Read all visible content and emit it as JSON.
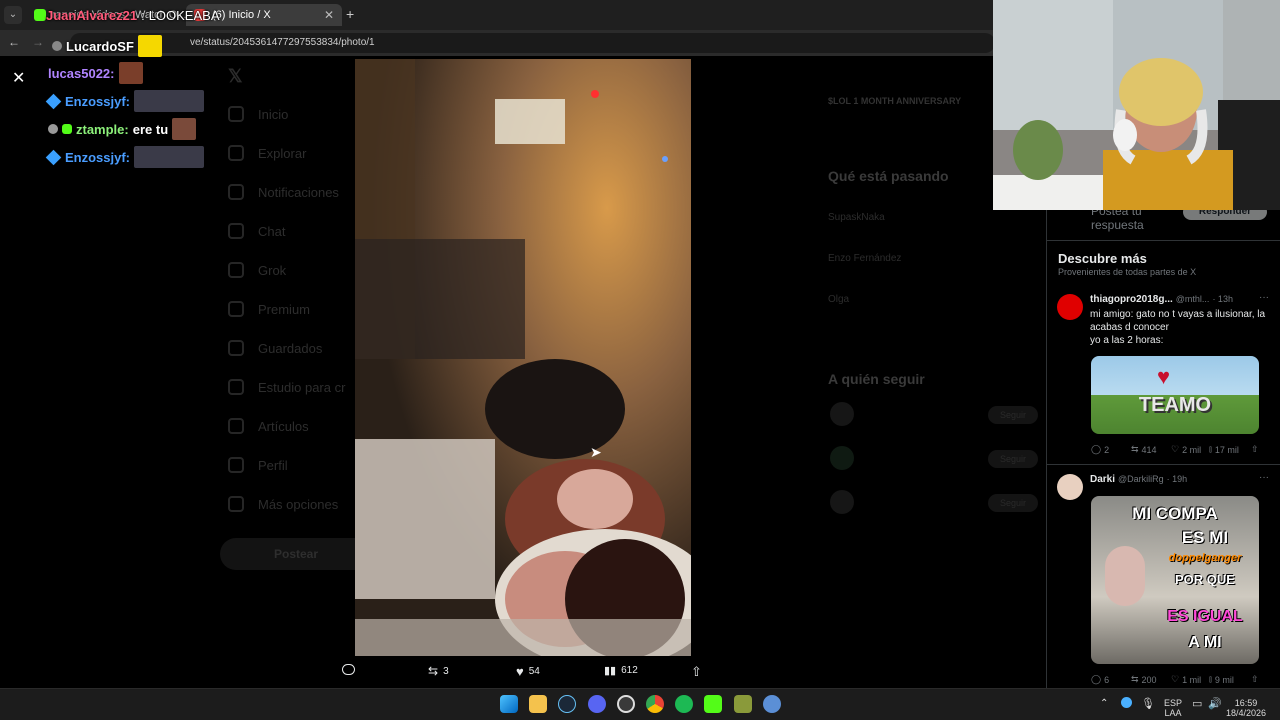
{
  "browser": {
    "tab1_title": "ranoide Videos - Watch O...",
    "tab2_title": "(6) Inicio / X",
    "url": "ve/status/2045361477297553834/photo/1",
    "new_tab_icon": "plus-icon"
  },
  "chat": {
    "overlay_top_user": "JuanAlvarez21",
    "overlay_top_msg": "LOOKEABA",
    "overlay_second_user": "LucardoSF",
    "messages": [
      {
        "user": "lucas5022:",
        "color": "#b084ff",
        "text": ""
      },
      {
        "user": "Enzossjyf:",
        "color": "#4a9dff",
        "text": ""
      },
      {
        "user": "ztample:",
        "color": "#8cf07a",
        "text": "ere tu"
      },
      {
        "user": "Enzossjyf:",
        "color": "#4a9dff",
        "text": ""
      }
    ]
  },
  "sidebar": {
    "items": [
      "Inicio",
      "Explorar",
      "Notificaciones",
      "Chat",
      "Grok",
      "Premium",
      "Guardados",
      "Estudio para cr",
      "Artículos",
      "Perfil",
      "Más opciones"
    ],
    "post_label": "Postear"
  },
  "trends": {
    "header": "Qué está pasando",
    "event": "$LOL 1 MONTH ANNIVERSARY",
    "items": [
      "SupaskNaka",
      "Enzo Fernández",
      "Olga"
    ],
    "follow_header": "A quién seguir",
    "follow_label": "Seguir"
  },
  "photo_actions": {
    "replies": "",
    "reposts": "3",
    "likes": "54",
    "views": "612"
  },
  "right_panel": {
    "reply_placeholder": "Postea tu respuesta",
    "reply_button": "Responder",
    "discover_title": "Descubre más",
    "discover_sub": "Provenientes de todas partes de X",
    "tweets": [
      {
        "name": "thiagopro2018g...",
        "handle": "@mthl...",
        "time": "· 13h",
        "text": "mi amigo: gato no t vayas a ilusionar, la acabas d conocer\nyo a las 2 horas:",
        "image_text": "TEAMO",
        "stats": {
          "replies": "2",
          "reposts": "414",
          "likes": "2 mil",
          "views": "17 mil"
        }
      },
      {
        "name": "Darki",
        "handle": "@DarkiliRg",
        "time": "· 19h",
        "text": "",
        "image_lines": [
          "MI COMPA",
          "ES MI",
          "doppelganger",
          "POR QUE",
          "ES IGUAL",
          "A MI"
        ],
        "stats": {
          "replies": "6",
          "reposts": "200",
          "likes": "1 mil",
          "views": "9 mil"
        }
      }
    ]
  },
  "taskbar": {
    "lang_top": "ESP",
    "lang_bottom": "LAA",
    "time": "16:59",
    "date": "18/4/2026"
  },
  "colors": {
    "x_blue": "#1d9bf0",
    "text_secondary": "#71767b",
    "taskbar_bg": "#1c1c1c"
  }
}
